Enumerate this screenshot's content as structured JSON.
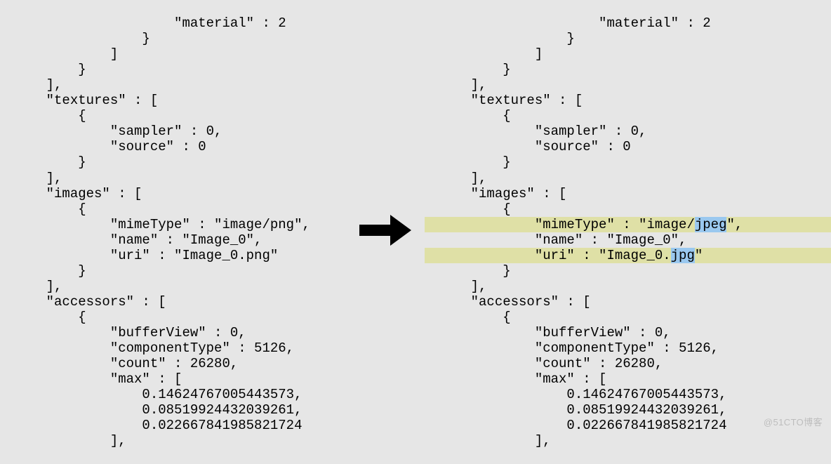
{
  "watermark": "@51CTO博客",
  "left": {
    "l00": "                    \"material\" : 2",
    "l01": "                }",
    "l02": "            ]",
    "l03": "        }",
    "l04": "    ],",
    "l05": "    \"textures\" : [",
    "l06": "        {",
    "l07": "            \"sampler\" : 0,",
    "l08": "            \"source\" : 0",
    "l09": "        }",
    "l10": "    ],",
    "l11": "    \"images\" : [",
    "l12": "        {",
    "l13": "            \"mimeType\" : \"image/png\",",
    "l14": "            \"name\" : \"Image_0\",",
    "l15": "            \"uri\" : \"Image_0.png\"",
    "l16": "        }",
    "l17": "    ],",
    "l18": "    \"accessors\" : [",
    "l19": "        {",
    "l20": "            \"bufferView\" : 0,",
    "l21": "            \"componentType\" : 5126,",
    "l22": "            \"count\" : 26280,",
    "l23": "            \"max\" : [",
    "l24": "                0.14624767005443573,",
    "l25": "                0.08519924432039261,",
    "l26": "                0.022667841985821724",
    "l27": "            ],"
  },
  "right": {
    "l00": "                    \"material\" : 2",
    "l01": "                }",
    "l02": "            ]",
    "l03": "        }",
    "l04": "    ],",
    "l05": "    \"textures\" : [",
    "l06": "        {",
    "l07": "            \"sampler\" : 0,",
    "l08": "            \"source\" : 0",
    "l09": "        }",
    "l10": "    ],",
    "l11": "    \"images\" : [",
    "l12": "        {",
    "l13a": "            \"mimeType\" : \"image/",
    "l13sel": "jpeg",
    "l13b": "\",",
    "l14": "            \"name\" : \"Image_0\",",
    "l15a": "            \"uri\" : \"Image_0.",
    "l15sel": "jpg",
    "l15b": "\"",
    "l16": "        }",
    "l17": "    ],",
    "l18": "    \"accessors\" : [",
    "l19": "        {",
    "l20": "            \"bufferView\" : 0,",
    "l21": "            \"componentType\" : 5126,",
    "l22": "            \"count\" : 26280,",
    "l23": "            \"max\" : [",
    "l24": "                0.14624767005443573,",
    "l25": "                0.08519924432039261,",
    "l26": "                0.022667841985821724",
    "l27": "            ],"
  }
}
